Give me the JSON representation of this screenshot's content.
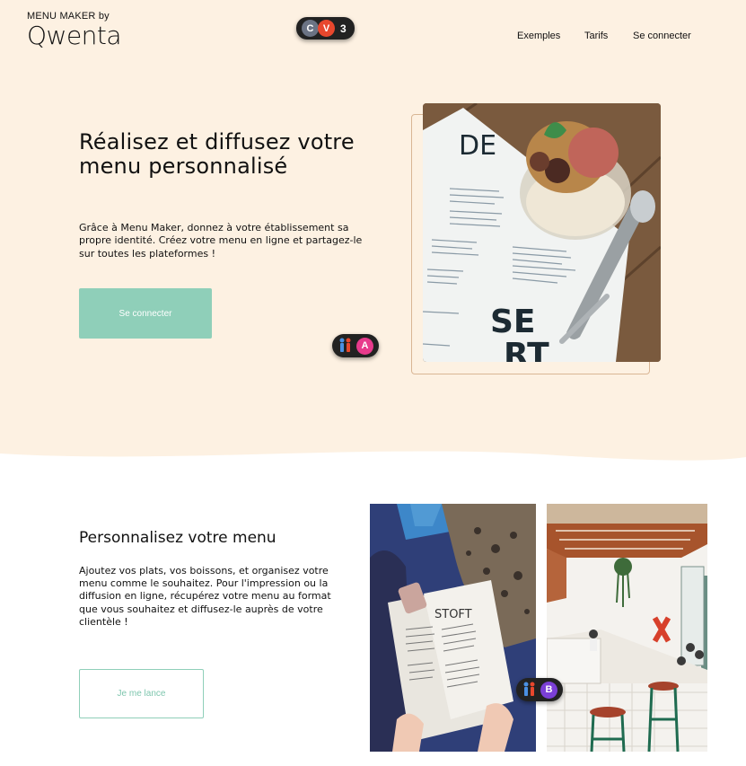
{
  "brand": {
    "tagline": "MENU MAKER by",
    "name": "Qwenta"
  },
  "top_badge": {
    "initial_1": "C",
    "initial_2": "V",
    "count": "3"
  },
  "nav": {
    "examples": "Exemples",
    "pricing": "Tarifs",
    "login": "Se connecter"
  },
  "hero": {
    "title": "Réalisez et diffusez votre menu personnalisé",
    "description": "Grâce à Menu Maker, donnez à votre établissement sa propre identité. Créez votre menu en ligne et partagez-le sur toutes les plateformes !",
    "cta": "Se connecter",
    "badge_letter": "A",
    "image_text_top": "DE",
    "image_text_bottom_1": "SE",
    "image_text_bottom_2": "RT"
  },
  "section2": {
    "title": "Personnalisez votre menu",
    "description": "Ajoutez vos plats, vos boissons, et organisez votre menu comme le souhaitez. Pour l'impression ou la diffusion en ligne, récupérez votre menu au format que vous souhaitez et diffusez-le auprès de votre clientèle !",
    "cta": "Je me lance",
    "badge_letter": "B",
    "menu_card_title": "STOFT"
  },
  "colors": {
    "hero_bg": "#fdf1e2",
    "accent": "#8fcfb9",
    "badge_v": "#e8472d",
    "badge_c": "#6b7384",
    "badge_a": "#e83a8c",
    "badge_b": "#7b3fd6"
  }
}
